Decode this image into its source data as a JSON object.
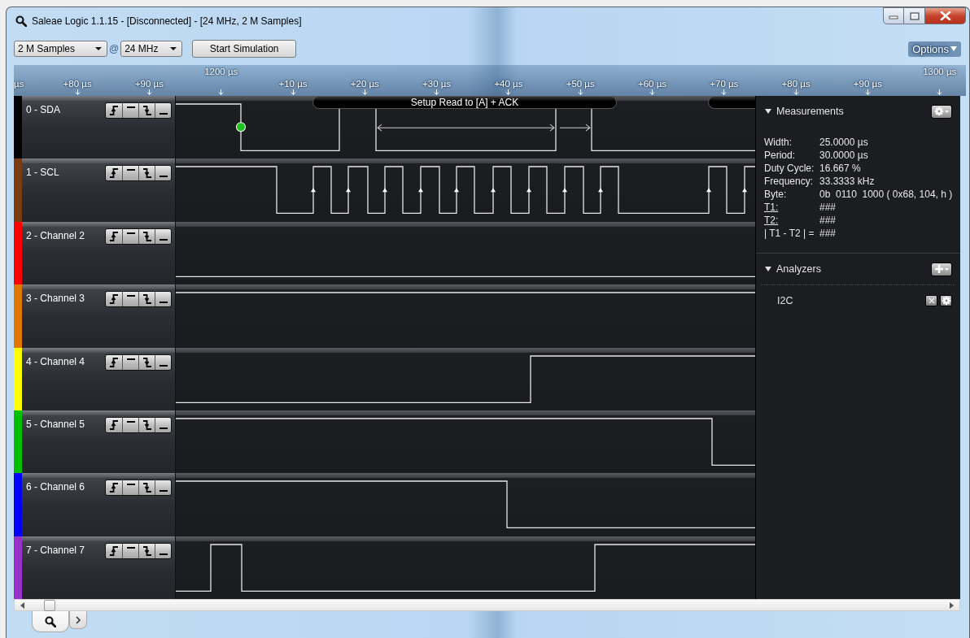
{
  "window": {
    "title": "Saleae Logic 1.1.15 - [Disconnected] - [24 MHz, 2 M Samples]"
  },
  "toolbar": {
    "sample_depth": "2 M Samples",
    "at_sign": "@",
    "sample_rate": "24 MHz",
    "start_button": "Start Simulation",
    "options": "Options"
  },
  "ruler": {
    "ticks": [
      {
        "label": "µs"
      },
      {
        "label": "+80 µs"
      },
      {
        "label": "+90 µs"
      },
      {
        "major": "1200 µs"
      },
      {
        "label": "+10 µs"
      },
      {
        "label": "+20 µs"
      },
      {
        "label": "+30 µs"
      },
      {
        "label": "+40 µs"
      },
      {
        "label": "+50 µs"
      },
      {
        "label": "+60 µs"
      },
      {
        "label": "+70 µs"
      },
      {
        "label": "+80 µs"
      },
      {
        "label": "+90 µs"
      },
      {
        "major": "1300 µs"
      }
    ]
  },
  "decode": {
    "label": "Setup Read to [A] + ACK"
  },
  "channels": [
    {
      "name": "0 - SDA",
      "color": "#000000"
    },
    {
      "name": "1 - SCL",
      "color": "#7a3d12"
    },
    {
      "name": "2 - Channel 2",
      "color": "#ff0000"
    },
    {
      "name": "3 - Channel 3",
      "color": "#e07800"
    },
    {
      "name": "4 - Channel 4",
      "color": "#ffff00"
    },
    {
      "name": "5 - Channel 5",
      "color": "#00c000"
    },
    {
      "name": "6 - Channel 6",
      "color": "#0000ff"
    },
    {
      "name": "7 - Channel 7",
      "color": "#9b30c8"
    }
  ],
  "measurements": {
    "title": "Measurements",
    "items": [
      {
        "label": "Width:",
        "value": "25.0000 µs",
        "underlined": false
      },
      {
        "label": "Period:",
        "value": "30.0000 µs",
        "underlined": false
      },
      {
        "label": "Duty Cycle:",
        "value": "16.667 %",
        "underlined": false
      },
      {
        "label": "Frequency:",
        "value": "33.3333 kHz",
        "underlined": false
      },
      {
        "label": "Byte:",
        "value": "0b  0110  1000 ( 0x68, 104, h )",
        "underlined": false
      },
      {
        "label": "T1:",
        "value": "###",
        "underlined": true
      },
      {
        "label": "T2:",
        "value": "###",
        "underlined": true
      },
      {
        "label": "| T1 - T2 | =",
        "value": "###",
        "underlined": false
      }
    ]
  },
  "analyzers": {
    "title": "Analyzers",
    "items": [
      {
        "name": "I2C"
      }
    ]
  },
  "bottom_tabs": [
    {
      "kind": "search",
      "selected": true
    },
    {
      "kind": "next",
      "selected": false
    }
  ]
}
